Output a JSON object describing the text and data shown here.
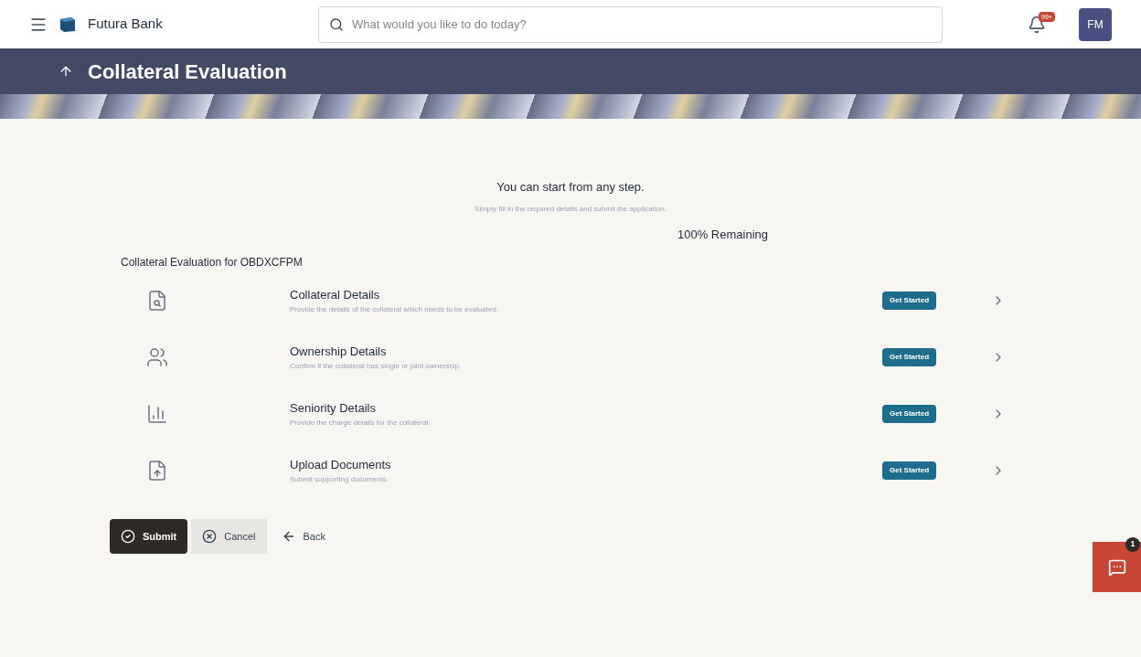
{
  "header": {
    "brand": "Futura Bank",
    "search": {
      "placeholder": "What would you like to do today?"
    },
    "notification_badge": "99+",
    "avatar": "FM"
  },
  "page_title": "Collateral Evaluation",
  "intro": {
    "heading": "You can start from any step.",
    "subheading": "Simply fill in the required details and submit the application.",
    "progress": "100% Remaining"
  },
  "section_title": "Collateral Evaluation for OBDXCFPM",
  "steps": [
    {
      "kind": "collateral",
      "title": "Collateral Details",
      "description": "Provide the details of the collateral which needs to be evaluated.",
      "status": "Get Started"
    },
    {
      "kind": "ownership",
      "title": "Ownership Details",
      "description": "Confirm if the collateral has single or joint ownership.",
      "status": "Get Started"
    },
    {
      "kind": "seniority",
      "title": "Seniority Details",
      "description": "Provide the charge details for the collateral.",
      "status": "Get Started"
    },
    {
      "kind": "upload",
      "title": "Upload Documents",
      "description": "Submit supporting documents.",
      "status": "Get Started"
    }
  ],
  "actions": {
    "submit": "Submit",
    "cancel": "Cancel",
    "back": "Back"
  },
  "chat": {
    "count": "1"
  }
}
